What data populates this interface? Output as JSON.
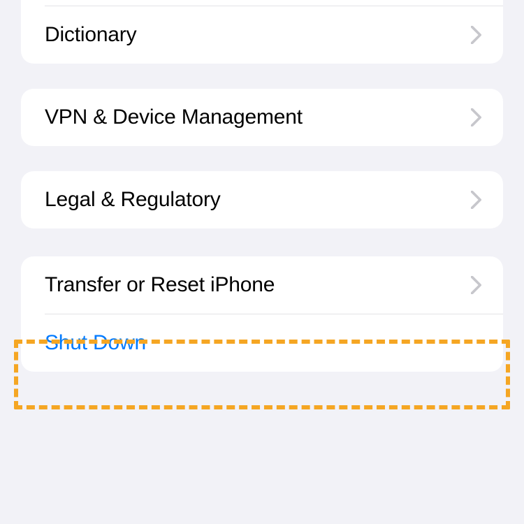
{
  "groups": {
    "g1": {
      "items": [
        {
          "label": "Dictionary",
          "chevron": true,
          "link": false
        }
      ]
    },
    "g2": {
      "items": [
        {
          "label": "VPN & Device Management",
          "chevron": true,
          "link": false
        }
      ]
    },
    "g3": {
      "items": [
        {
          "label": "Legal & Regulatory",
          "chevron": true,
          "link": false
        }
      ]
    },
    "g4": {
      "items": [
        {
          "label": "Transfer or Reset iPhone",
          "chevron": true,
          "link": false
        },
        {
          "label": "Shut Down",
          "chevron": false,
          "link": true
        }
      ]
    }
  }
}
